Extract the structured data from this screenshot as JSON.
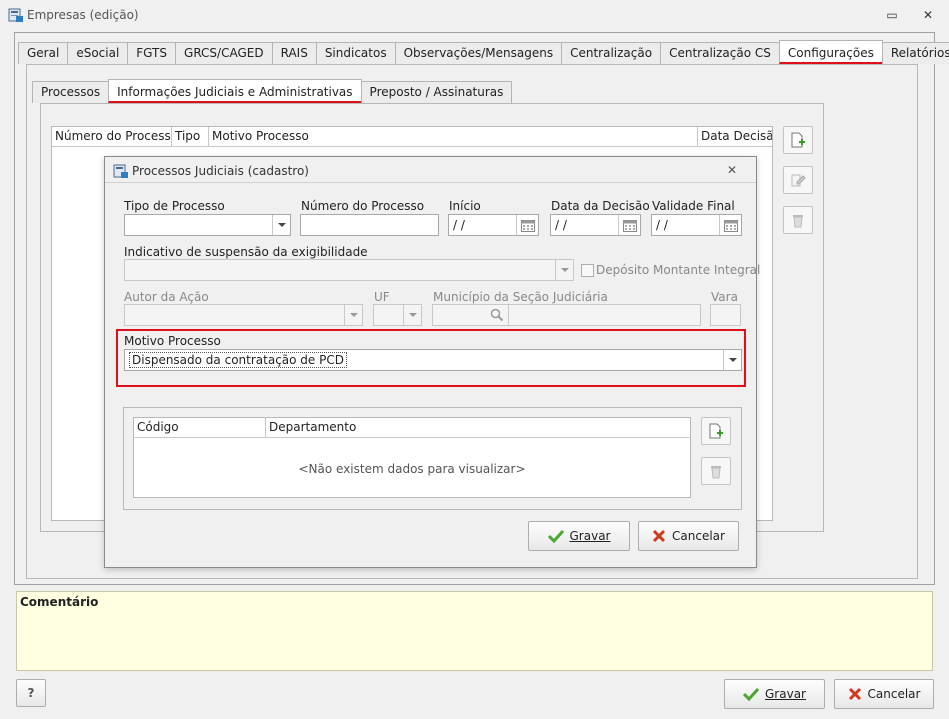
{
  "window": {
    "title": "Empresas (edição)",
    "minimize_glyph": "▭",
    "close_glyph": "✕"
  },
  "main_tabs": [
    {
      "label": "Geral"
    },
    {
      "label": "eSocial"
    },
    {
      "label": "FGTS"
    },
    {
      "label": "GRCS/CAGED"
    },
    {
      "label": "RAIS"
    },
    {
      "label": "Sindicatos"
    },
    {
      "label": "Observações/Mensagens"
    },
    {
      "label": "Centralização"
    },
    {
      "label": "Centralização CS"
    },
    {
      "label": "Configurações",
      "active": true
    },
    {
      "label": "Relatórios"
    }
  ],
  "sub_tabs": [
    {
      "label": "Processos"
    },
    {
      "label": "Informações Judiciais e Administrativas",
      "active": true
    },
    {
      "label": "Preposto / Assinaturas"
    }
  ],
  "process_grid": {
    "columns": [
      "Número do Processo",
      "Tipo",
      "Motivo Processo",
      "Data Decisão"
    ]
  },
  "dialog": {
    "title": "Processos Judiciais (cadastro)",
    "close_glyph": "✕",
    "tipo_processo": {
      "label": "Tipo de Processo",
      "value": ""
    },
    "numero_processo": {
      "label": "Número do Processo",
      "value": ""
    },
    "inicio": {
      "label": "Início",
      "value": " / /"
    },
    "data_decisao": {
      "label": "Data da Decisão",
      "value": " / /"
    },
    "validade_final": {
      "label": "Validade Final",
      "value": " / /"
    },
    "indicativo": {
      "label": "Indicativo de suspensão da exigibilidade",
      "value": ""
    },
    "deposito": {
      "label": "Depósito Montante Integral"
    },
    "autor_acao": {
      "label": "Autor da Ação"
    },
    "uf": {
      "label": "UF"
    },
    "municipio": {
      "label": "Município da Seção Judiciária"
    },
    "vara": {
      "label": "Vara"
    },
    "motivo": {
      "label": "Motivo Processo",
      "value": "Dispensado da contratação de PCD"
    },
    "dept_grid": {
      "columns": [
        "Código",
        "Departamento"
      ],
      "empty_text": "<Não existem dados para visualizar>"
    },
    "save_label": "Gravar",
    "cancel_label": "Cancelar"
  },
  "comment": {
    "label": "Comentário"
  },
  "footer": {
    "help_label": "?",
    "save_label": "Gravar",
    "cancel_label": "Cancelar"
  },
  "colors": {
    "accent_red": "#e0101a",
    "comment_bg": "#ffffe1"
  }
}
